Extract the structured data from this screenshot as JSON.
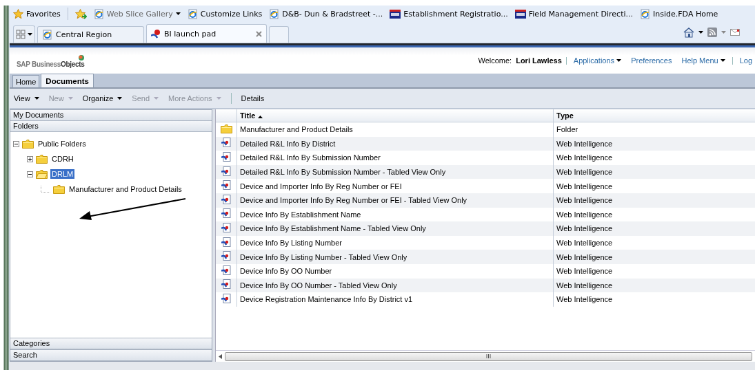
{
  "favorites_bar": {
    "favorites": "Favorites",
    "links": [
      {
        "label": "Web Slice Gallery",
        "kind": "page",
        "dropdown": true,
        "disabled": true
      },
      {
        "label": "Customize Links",
        "kind": "page",
        "dropdown": false,
        "disabled": false
      },
      {
        "label": "D&B- Dun & Bradstreet -...",
        "kind": "page",
        "dropdown": false,
        "disabled": false
      },
      {
        "label": "Establishment Registratio...",
        "kind": "agency",
        "dropdown": false,
        "disabled": false
      },
      {
        "label": "Field Management Directi...",
        "kind": "agency",
        "dropdown": false,
        "disabled": false
      },
      {
        "label": "Inside.FDA Home",
        "kind": "page",
        "dropdown": false,
        "disabled": false
      }
    ]
  },
  "browser_tabs": [
    {
      "label": "Central Region",
      "kind": "page",
      "selected": false
    },
    {
      "label": "BI launch pad",
      "kind": "launchpad",
      "selected": true
    }
  ],
  "header": {
    "logo": "SAP Business**Objects**",
    "welcome": "Welcome:",
    "user": "Lori Lawless",
    "links": [
      {
        "label": "Applications",
        "dropdown": true
      },
      {
        "label": "Preferences",
        "dropdown": false
      },
      {
        "label": "Help Menu",
        "dropdown": true
      },
      {
        "label": "Log",
        "dropdown": false
      }
    ]
  },
  "app_tabs": [
    {
      "label": "Home",
      "selected": false
    },
    {
      "label": "Documents",
      "selected": true
    }
  ],
  "toolbar": [
    {
      "label": "View",
      "dropdown": true,
      "disabled": false
    },
    {
      "label": "New",
      "dropdown": true,
      "disabled": true
    },
    {
      "label": "Organize",
      "dropdown": true,
      "disabled": false
    },
    {
      "label": "Send",
      "dropdown": true,
      "disabled": true
    },
    {
      "label": "More Actions",
      "dropdown": true,
      "disabled": true
    },
    {
      "label": "Details",
      "dropdown": false,
      "disabled": false
    }
  ],
  "sidebar": {
    "top_sections": [
      "My Documents",
      "Folders"
    ],
    "tree": [
      {
        "label": "Public Folders",
        "expanded": true,
        "selected": false,
        "children": [
          {
            "label": "CDRH",
            "expanded": false,
            "selected": false
          },
          {
            "label": "DRLM",
            "expanded": true,
            "selected": true,
            "children": [
              {
                "label": "Manufacturer and Product Details",
                "selected": false
              }
            ]
          }
        ]
      }
    ],
    "bottom_sections": [
      "Categories",
      "Search"
    ]
  },
  "table": {
    "columns": [
      "Title",
      "Type"
    ],
    "rows": [
      {
        "kind": "folder",
        "title": "Manufacturer and Product Details",
        "type": "Folder"
      },
      {
        "kind": "report",
        "title": "Detailed R&L Info By District",
        "type": "Web Intelligence"
      },
      {
        "kind": "report",
        "title": "Detailed R&L Info By Submission Number",
        "type": "Web Intelligence"
      },
      {
        "kind": "report",
        "title": "Detailed R&L Info By Submission Number - Tabled View Only",
        "type": "Web Intelligence"
      },
      {
        "kind": "report",
        "title": "Device and Importer Info By Reg Number or FEI",
        "type": "Web Intelligence"
      },
      {
        "kind": "report",
        "title": "Device and Importer Info By Reg Number or FEI - Tabled View Only",
        "type": "Web Intelligence"
      },
      {
        "kind": "report",
        "title": "Device Info By Establishment Name",
        "type": "Web Intelligence"
      },
      {
        "kind": "report",
        "title": "Device Info By Establishment Name - Tabled View Only",
        "type": "Web Intelligence"
      },
      {
        "kind": "report",
        "title": "Device Info By Listing Number",
        "type": "Web Intelligence"
      },
      {
        "kind": "report",
        "title": "Device Info By Listing Number - Tabled View Only",
        "type": "Web Intelligence"
      },
      {
        "kind": "report",
        "title": "Device Info By OO Number",
        "type": "Web Intelligence"
      },
      {
        "kind": "report",
        "title": "Device Info By OO Number - Tabled View Only",
        "type": "Web Intelligence"
      },
      {
        "kind": "report",
        "title": "Device Registration Maintenance Info By District v1",
        "type": "Web Intelligence"
      }
    ]
  }
}
